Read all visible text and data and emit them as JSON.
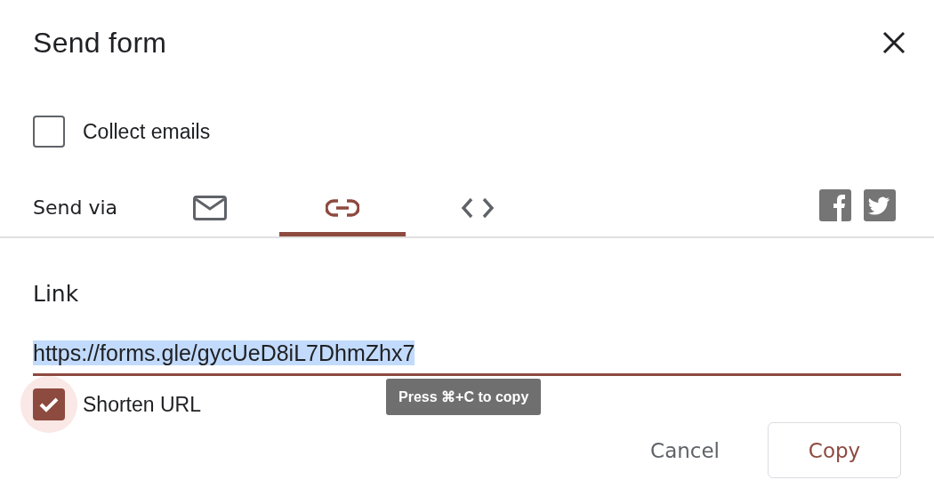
{
  "dialog": {
    "title": "Send form"
  },
  "collect_emails": {
    "label": "Collect emails",
    "checked": false
  },
  "send_via": {
    "label": "Send via",
    "tabs": [
      {
        "kind": "email",
        "selected": false
      },
      {
        "kind": "link",
        "selected": true
      },
      {
        "kind": "embed",
        "selected": false
      }
    ]
  },
  "link": {
    "heading": "Link",
    "value": "https://forms.gle/gycUeD8iL7DhmZhx7",
    "shorten": {
      "label": "Shorten URL",
      "checked": true
    },
    "tooltip": "Press ⌘+C to copy"
  },
  "buttons": [
    {
      "kind": "text",
      "label": "Cancel"
    },
    {
      "kind": "outlined",
      "label": "Copy"
    }
  ]
}
